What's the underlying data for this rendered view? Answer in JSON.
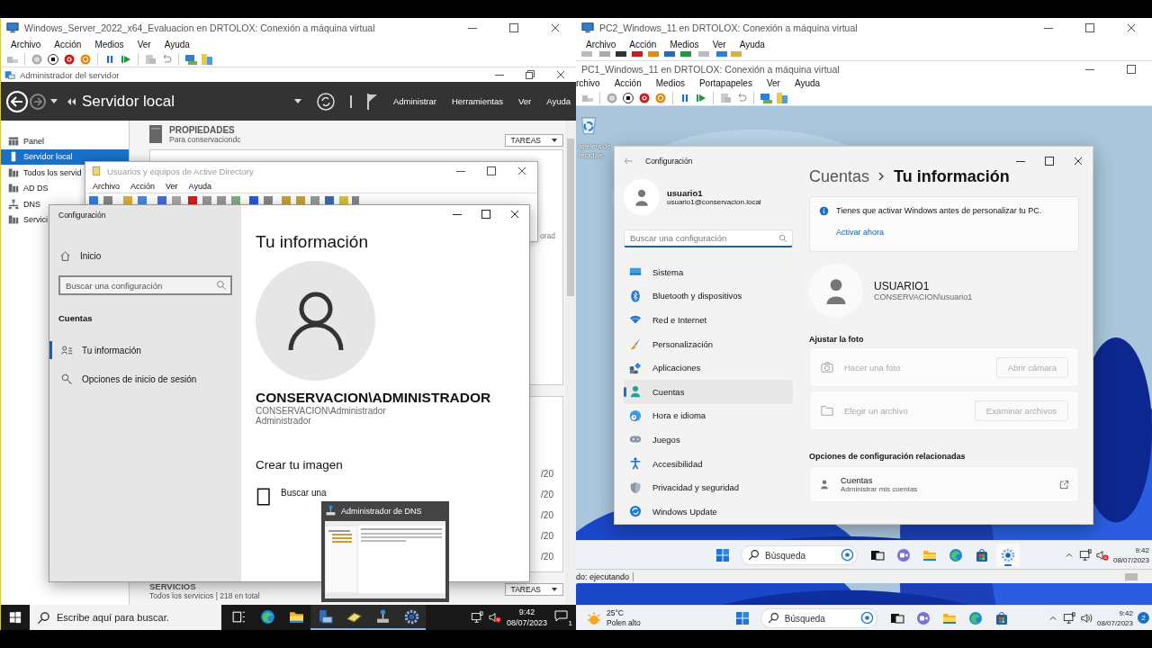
{
  "left_vm": {
    "title": "Windows_Server_2022_x64_Evaluacion en DRTOLOX: Conexión a máquina virtual",
    "menu": [
      "Archivo",
      "Acción",
      "Medios",
      "Ver",
      "Ayuda"
    ],
    "server_manager": {
      "title": "Administrador del servidor",
      "header": "Servidor local",
      "header_menu": [
        "Administrar",
        "Herramientas",
        "Ver",
        "Ayuda"
      ],
      "sidebar": [
        {
          "label": "Panel",
          "kind": "grid",
          "selected": false
        },
        {
          "label": "Servidor local",
          "kind": "server",
          "selected": true
        },
        {
          "label": "Todos los servid",
          "kind": "servers",
          "selected": false
        },
        {
          "label": "AD DS",
          "kind": "servers",
          "selected": false
        },
        {
          "label": "DNS",
          "kind": "network",
          "selected": false
        },
        {
          "label": "Servici",
          "kind": "servers",
          "selected": false
        }
      ],
      "properties": {
        "title": "PROPIEDADES",
        "subtitle": "Para conservaciondc",
        "tasks": "TAREAS",
        "fragment": "orad"
      },
      "dates": [
        "/20",
        "/20",
        "/20",
        "/20",
        "/20"
      ],
      "services": {
        "title": "SERVICIOS",
        "subtitle": "Todos los servicios | 218 en total",
        "tasks": "TAREAS"
      }
    },
    "ad_window": {
      "title": "Usuarios y equipos de Active Directory",
      "menu": [
        "Archivo",
        "Acción",
        "Ver",
        "Ayuda"
      ]
    },
    "settings": {
      "title": "Configuración",
      "home": "Inicio",
      "search_placeholder": "Buscar una configuración",
      "section": "Cuentas",
      "nav": [
        {
          "label": "Tu información",
          "kind": "person",
          "selected": true
        },
        {
          "label": "Opciones de inicio de sesión",
          "kind": "key",
          "selected": false
        }
      ],
      "heading": "Tu información",
      "account_name": "CONSERVACION\\ADMINISTRADOR",
      "account_id": "CONSERVACION\\Administrador",
      "role": "Administrador",
      "create_heading": "Crear tu imagen",
      "create_item": "Buscar una"
    },
    "dns_preview": {
      "title": "Administrador de DNS"
    },
    "taskbar": {
      "search_placeholder": "Escribe aquí para buscar.",
      "apps": [
        {
          "kind": "taskview",
          "running": false
        },
        {
          "kind": "browser",
          "running": false
        },
        {
          "kind": "folder",
          "running": false
        },
        {
          "kind": "server",
          "running": true
        },
        {
          "kind": "book",
          "running": true
        },
        {
          "kind": "network",
          "running": true
        },
        {
          "kind": "gear",
          "running": true
        }
      ],
      "time": "9:42",
      "date": "08/07/2023",
      "notifications": "1"
    }
  },
  "right_vm": {
    "title": "PC2_Windows_11 en DRTOLOX: Conexión a máquina virtual",
    "menu": [
      "Archivo",
      "Acción",
      "Medios",
      "Ver",
      "Ayuda"
    ],
    "taskbar": {
      "weather_temp": "25°C",
      "weather_text": "Polen alto",
      "search_placeholder": "Búsqueda",
      "apps": [
        {
          "kind": "taskview",
          "running": false
        },
        {
          "kind": "video",
          "running": false
        },
        {
          "kind": "folder",
          "running": false
        },
        {
          "kind": "browser",
          "running": false
        },
        {
          "kind": "store",
          "running": false
        }
      ],
      "time": "9:42",
      "date": "08/07/2023",
      "notifications": "2"
    }
  },
  "front_vm": {
    "title": "PC1_Windows_11 en DRTOLOX: Conexión a máquina virtual",
    "menu": [
      "rchivo",
      "Acción",
      "Medios",
      "Portapapeles",
      "Ver",
      "Ayuda"
    ],
    "desktop_icon": "apelera de reciclaje",
    "status": "do: ejecutando",
    "settings": {
      "title": "Configuración",
      "user_name": "usuario1",
      "user_email": "usuario1@conservacion.local",
      "search_placeholder": "Buscar una configuración",
      "nav": [
        {
          "label": "Sistema",
          "kind": "system",
          "selected": false
        },
        {
          "label": "Bluetooth y dispositivos",
          "kind": "bluetooth",
          "selected": false
        },
        {
          "label": "Red e Internet",
          "kind": "wifi",
          "selected": false
        },
        {
          "label": "Personalización",
          "kind": "brush",
          "selected": false
        },
        {
          "label": "Aplicaciones",
          "kind": "apps",
          "selected": false
        },
        {
          "label": "Cuentas",
          "kind": "account",
          "selected": true
        },
        {
          "label": "Hora e idioma",
          "kind": "globe",
          "selected": false
        },
        {
          "label": "Juegos",
          "kind": "gamepad",
          "selected": false
        },
        {
          "label": "Accesibilidad",
          "kind": "access",
          "selected": false
        },
        {
          "label": "Privacidad y seguridad",
          "kind": "shield",
          "selected": false
        },
        {
          "label": "Windows Update",
          "kind": "update",
          "selected": false
        }
      ],
      "breadcrumb": [
        "Cuentas",
        "Tu información"
      ],
      "notice": "Tienes que activar Windows antes de personalizar tu PC.",
      "notice_link": "Activar ahora",
      "account_name": "USUARIO1",
      "account_id": "CONSERVACION\\usuario1",
      "photo_heading": "Ajustar la foto",
      "photo_options": [
        {
          "kind": "camera",
          "label": "Hacer una foto",
          "button": "Abrir cámara"
        },
        {
          "kind": "folder_outline",
          "label": "Elegir un archivo",
          "button": "Examinar archivos"
        }
      ],
      "related_heading": "Opciones de configuración relacionadas",
      "related": [
        {
          "title": "Cuentas",
          "subtitle": "Administrar mis cuentas"
        }
      ]
    },
    "taskbar": {
      "search_placeholder": "Búsqueda",
      "apps": [
        {
          "kind": "taskview",
          "running": false
        },
        {
          "kind": "video",
          "running": false
        },
        {
          "kind": "folder",
          "running": false
        },
        {
          "kind": "browser",
          "running": false
        },
        {
          "kind": "store",
          "running": false
        },
        {
          "kind": "gear",
          "running": true
        }
      ],
      "time": "9:42",
      "date": "08/07/2023"
    }
  }
}
